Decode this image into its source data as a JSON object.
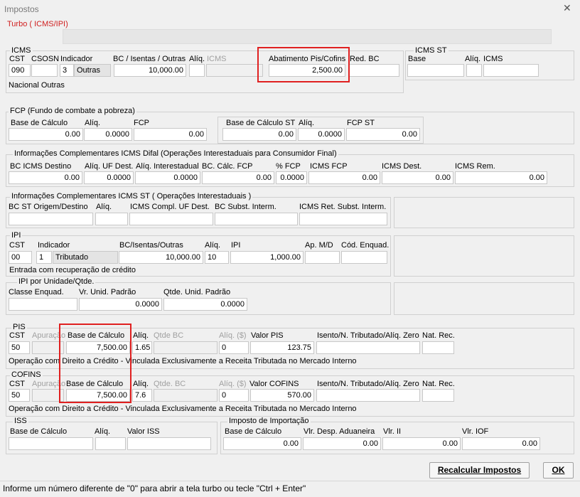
{
  "window": {
    "title": "Impostos",
    "close_glyph": "✕"
  },
  "turbo": {
    "label": "Turbo ( ICMS/IPI)"
  },
  "icms": {
    "title": "ICMS",
    "h_cst": "CST",
    "h_csosn": "CSOSN",
    "h_indicador": "Indicador",
    "h_bc": "BC / Isentas / Outras",
    "h_aliq": "Alíq.",
    "h_icms": "ICMS",
    "h_abat": "Abatimento Pis/Cofins",
    "h_redbc": "Red. BC",
    "cst": "090",
    "csosn": "",
    "ind_code": "3",
    "ind_text": "Outras",
    "bc": "10,000.00",
    "aliq": "",
    "icms": "",
    "abat": "2,500.00",
    "redbc": "",
    "desc": "Nacional Outras"
  },
  "icms_st": {
    "title": "ICMS ST",
    "h_base": "Base",
    "h_aliq": "Alíq.",
    "h_icms": "ICMS"
  },
  "fcp": {
    "title": "FCP (Fundo de combate a pobreza)",
    "h_base": "Base de Cálculo",
    "h_aliq": "Alíq.",
    "h_fcp": "FCP",
    "base": "0.00",
    "aliq": "0.0000",
    "fcp": "0.00",
    "h_base_st": "Base de Cálculo ST",
    "h_aliq_st": "Alíq.",
    "h_fcp_st": "FCP ST",
    "base_st": "0.00",
    "aliq_st": "0.0000",
    "fcp_st": "0.00"
  },
  "difal": {
    "title": "Informações Complementares ICMS Difal (Operações Interestaduais para Consumidor Final)",
    "h1": "BC ICMS Destino",
    "h2": "Alíq. UF Dest.",
    "h3": "Alíq. Interestadual",
    "h4": "BC. Cálc. FCP",
    "h5": "% FCP",
    "h6": "ICMS FCP",
    "h7": "ICMS Dest.",
    "h8": "ICMS Rem.",
    "v1": "0.00",
    "v2": "0.0000",
    "v3": "0.0000",
    "v4": "0.00",
    "v5": "0.0000",
    "v6": "0.00",
    "v7": "0.00",
    "v8": "0.00"
  },
  "st_inter": {
    "title": "Informações Complementares ICMS ST ( Operações Interestaduais )",
    "h1": "BC ST Origem/Destino",
    "h2": "Alíq.",
    "h3": "ICMS Compl. UF Dest.",
    "h4": "BC  Subst. Interm.",
    "h5": "ICMS Ret. Subst. Interm."
  },
  "ipi": {
    "title": "IPI",
    "h_cst": "CST",
    "h_ind": "Indicador",
    "h_bc": "BC/Isentas/Outras",
    "h_aliq": "Alíq.",
    "h_ipi": "IPI",
    "h_apmd": "Ap. M/D",
    "h_cod": "Cód. Enquad.",
    "cst": "00",
    "ind_code": "1",
    "ind_text": "Tributado",
    "bc": "10,000.00",
    "aliq": "10",
    "ipi": "1,000.00",
    "desc": "Entrada com recuperação de crédito"
  },
  "ipi_unid": {
    "title": "IPI por Unidade/Qtde.",
    "h1": "Classe Enquad.",
    "h2": "Vr. Unid. Padrão",
    "h3": "Qtde. Unid. Padrão",
    "vr": "0.0000",
    "qt": "0.0000"
  },
  "pis": {
    "title": "PIS",
    "h_cst": "CST",
    "h_apur": "Apuração",
    "h_base": "Base de Cálculo",
    "h_aliq": "Alíq.",
    "h_qtde": "Qtde BC",
    "h_aliqrs": "Alíq. ($)",
    "h_valor": "Valor PIS",
    "h_isento": "Isento/N. Tributado/Alíq. Zero",
    "h_nat": "Nat. Rec.",
    "cst": "50",
    "base": "7,500.00",
    "aliq": "1.65",
    "aliqrs": "0",
    "valor": "123.75",
    "desc": "Operação com Direito a Crédito - Vinculada Exclusivamente a Receita Tributada no Mercado Interno"
  },
  "cofins": {
    "title": "COFINS",
    "h_cst": "CST",
    "h_apur": "Apuração",
    "h_base": "Base de Cálculo",
    "h_aliq": "Alíq.",
    "h_qtde": "Qtde. BC",
    "h_aliqrs": "Alíq. ($)",
    "h_valor": "Valor COFINS",
    "h_isento": "Isento/N. Tributado/Alíq. Zero",
    "h_nat": "Nat. Rec.",
    "cst": "50",
    "base": "7,500.00",
    "aliq": "7.6",
    "aliqrs": "0",
    "valor": "570.00",
    "desc": "Operação com Direito a Crédito - Vinculada Exclusivamente a Receita Tributada no Mercado Interno"
  },
  "iss": {
    "title": "ISS",
    "h_base": "Base de Cálculo",
    "h_aliq": "Alíq.",
    "h_valor": "Valor ISS"
  },
  "import": {
    "title": "Imposto de Importação",
    "h1": "Base de Cálculo",
    "h2": "Vlr. Desp. Aduaneira",
    "h3": "Vlr. II",
    "h4": "Vlr. IOF",
    "v1": "0.00",
    "v2": "0.00",
    "v3": "0.00",
    "v4": "0.00"
  },
  "buttons": {
    "recalc": "Recalcular Impostos",
    "ok": "OK"
  },
  "status": {
    "text": "Informe um número diferente de \"0\" para abrir a tela turbo ou tecle \"Ctrl + Enter\""
  },
  "colors": {
    "highlight": "#e02020"
  }
}
